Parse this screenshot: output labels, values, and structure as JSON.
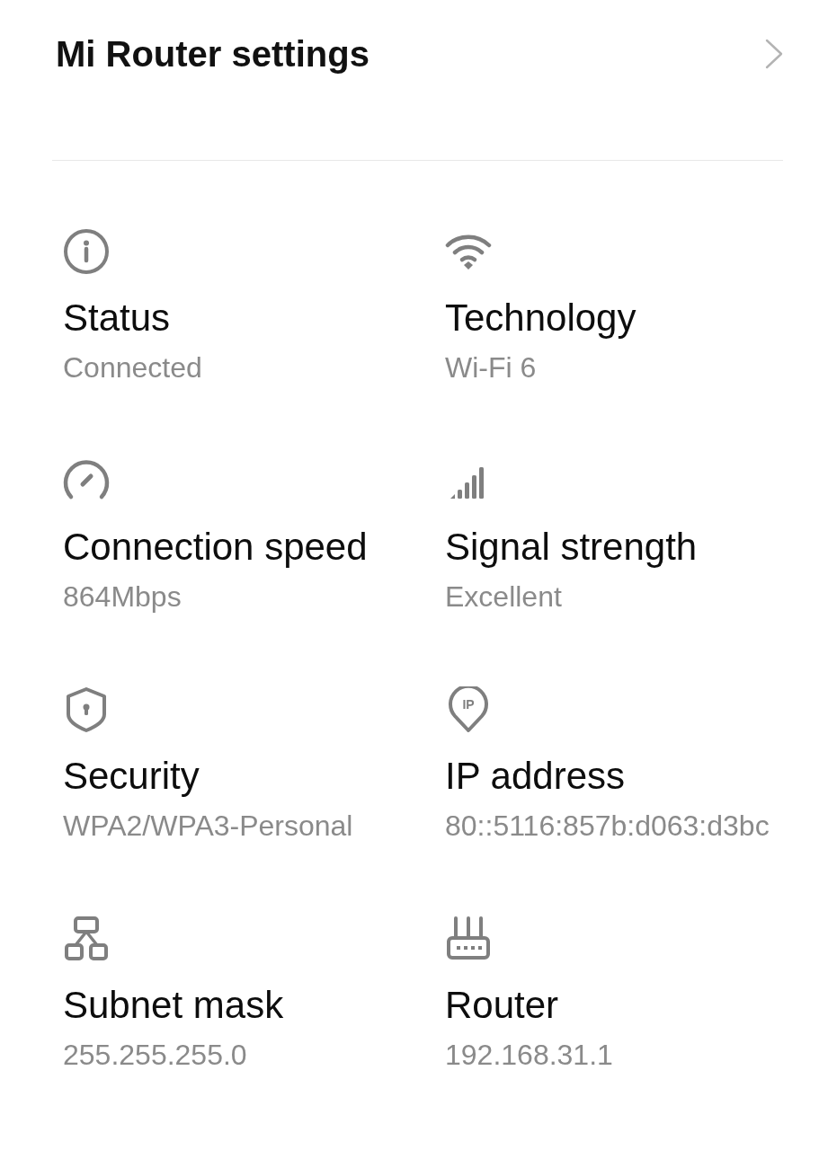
{
  "header": {
    "title": "Mi Router settings"
  },
  "details": [
    {
      "kind": "status",
      "label": "Status",
      "value": "Connected"
    },
    {
      "kind": "speed",
      "label": "Connection speed",
      "value": "864Mbps"
    },
    {
      "kind": "security",
      "label": "Security",
      "value": "WPA2/WPA3-Personal"
    },
    {
      "kind": "subnet",
      "label": "Subnet mask",
      "value": "255.255.255.0"
    },
    {
      "kind": "technology",
      "label": "Technology",
      "value": "Wi-Fi 6"
    },
    {
      "kind": "signal",
      "label": "Signal strength",
      "value": "Excellent"
    },
    {
      "kind": "address",
      "label": "IP address",
      "value": "80::5116:857b:d063:d3bc",
      "icon_text": "IP"
    },
    {
      "kind": "gateway",
      "label": "Router",
      "value": "192.168.31.1"
    }
  ]
}
